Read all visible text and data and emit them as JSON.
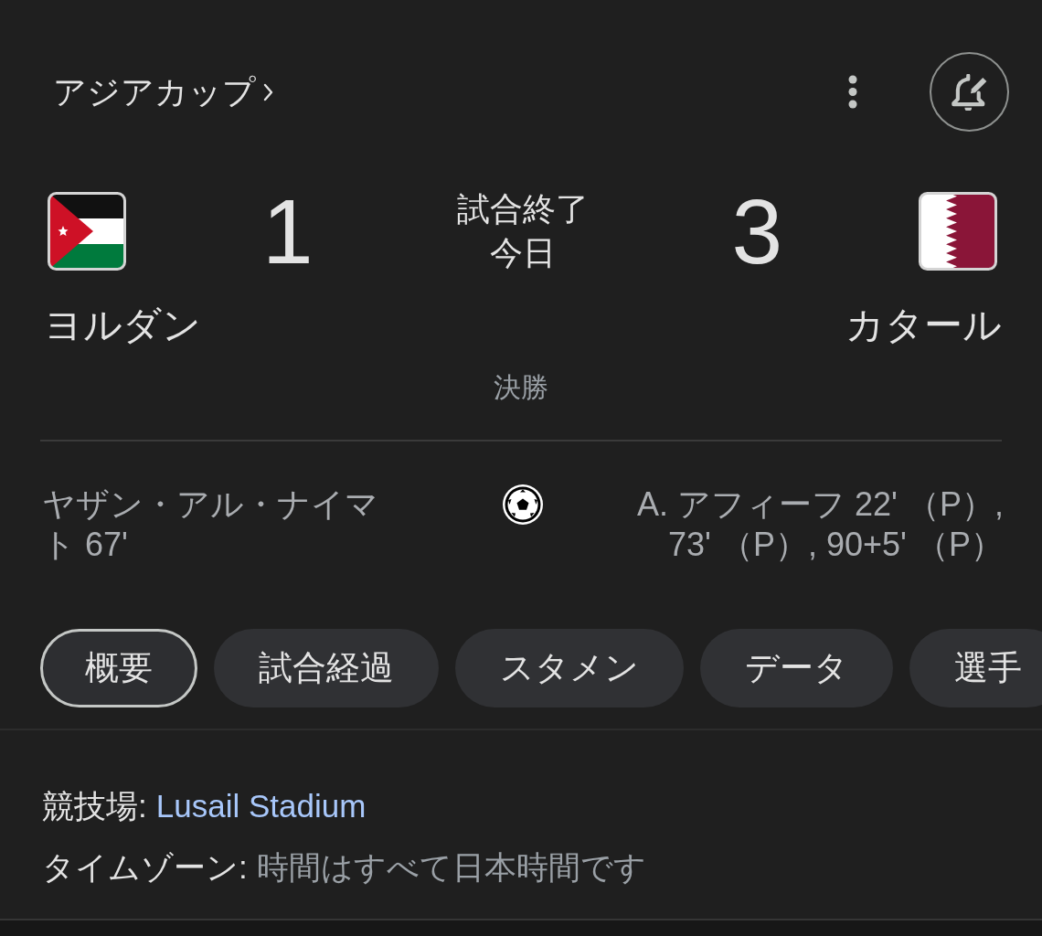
{
  "header": {
    "competition": "アジアカップ"
  },
  "match": {
    "status": "試合終了",
    "date": "今日",
    "stage": "決勝"
  },
  "teams": [
    {
      "name": "ヨルダン",
      "score": "1",
      "scorers": "ヤザン・アル・ナイマト 67'"
    },
    {
      "name": "カタール",
      "score": "3",
      "scorers": "A. アフィーフ 22' （P）, 73' （P）, 90+5' （P）"
    }
  ],
  "tabs": [
    {
      "label": "概要",
      "selected": true
    },
    {
      "label": "試合経過",
      "selected": false
    },
    {
      "label": "スタメン",
      "selected": false
    },
    {
      "label": "データ",
      "selected": false
    },
    {
      "label": "選手",
      "selected": false
    }
  ],
  "details": [
    {
      "kind": "link",
      "label": "競技場:",
      "value": "Lusail Stadium"
    },
    {
      "kind": "text",
      "label": "タイムゾーン:",
      "value": "時間はすべて日本時間です"
    }
  ]
}
